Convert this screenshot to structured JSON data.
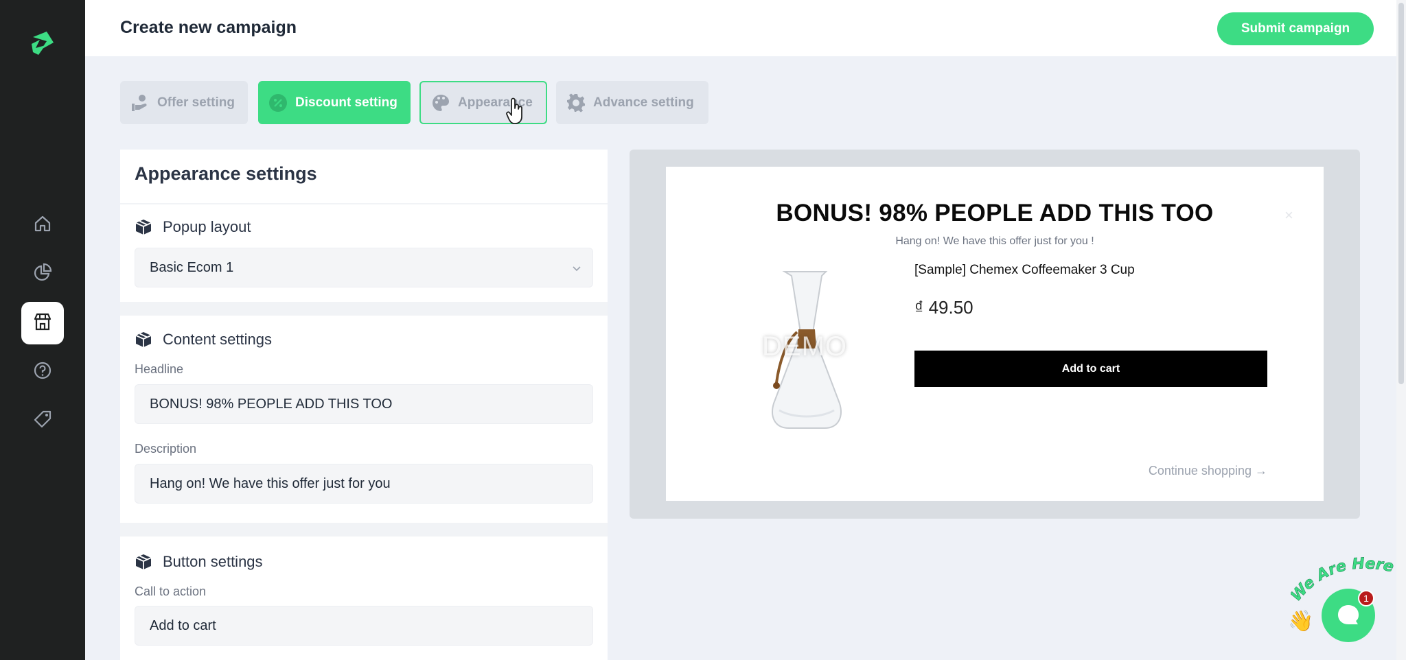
{
  "header": {
    "title": "Create new campaign",
    "submit_label": "Submit campaign"
  },
  "sidebar": {
    "items": [
      {
        "icon": "home-icon"
      },
      {
        "icon": "analytics-icon"
      },
      {
        "icon": "store-icon",
        "active": true
      },
      {
        "icon": "help-icon"
      },
      {
        "icon": "tag-icon"
      }
    ]
  },
  "tabs": [
    {
      "label": "Offer setting",
      "icon": "offer-icon"
    },
    {
      "label": "Discount setting",
      "icon": "discount-icon"
    },
    {
      "label": "Appearance",
      "icon": "palette-icon"
    },
    {
      "label": "Advance setting",
      "icon": "gear-icon"
    }
  ],
  "panel": {
    "title": "Appearance settings",
    "popup_layout": {
      "title": "Popup layout",
      "value": "Basic Ecom 1"
    },
    "content": {
      "title": "Content settings",
      "headline_label": "Headline",
      "headline_value": "BONUS! 98% PEOPLE ADD THIS TOO",
      "description_label": "Description",
      "description_value": "Hang on! We have this offer just for you"
    },
    "button": {
      "title": "Button settings",
      "cta_label": "Call to action",
      "cta_value": "Add to cart"
    }
  },
  "preview": {
    "headline": "BONUS! 98% PEOPLE ADD THIS TOO",
    "close": "×",
    "description": "Hang on! We have this offer just for you !",
    "product_name": "[Sample] Chemex Coffeemaker 3 Cup",
    "price": "₫ 49.50",
    "watermark": "DEMO",
    "add_to_cart": "Add to cart",
    "continue": "Continue shopping →"
  },
  "chat": {
    "text": "We Are Here!",
    "badge": "1"
  },
  "colors": {
    "accent": "#3ddc84",
    "sidebar": "#1f2121",
    "background": "#eef1f7"
  }
}
